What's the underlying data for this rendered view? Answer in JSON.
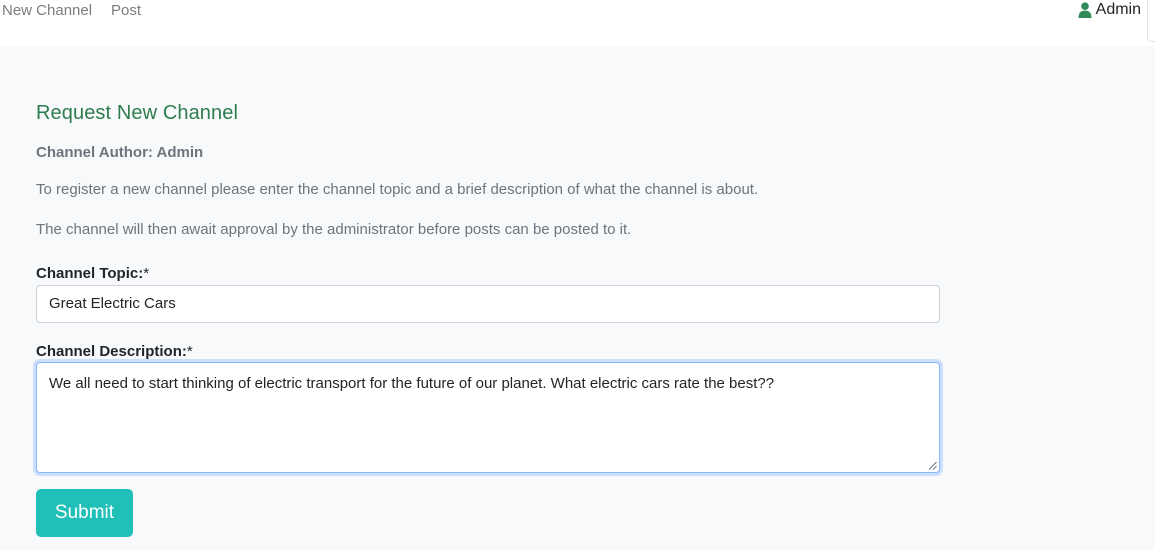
{
  "nav": {
    "new_channel": "New Channel",
    "post": "Post",
    "user_name": "Admin",
    "user_icon": "user-icon"
  },
  "form": {
    "heading": "Request New Channel",
    "author_line": "Channel Author: Admin",
    "intro_1": "To register a new channel please enter the channel topic and a brief description of what the channel is about.",
    "intro_2": "The channel will then await approval by the administrator before posts can be posted to it.",
    "topic_label": "Channel Topic:",
    "topic_required": "*",
    "topic_value": "Great Electric Cars",
    "description_label": "Channel Description:",
    "description_required": "*",
    "description_value": "We all need to start thinking of electric transport for the future of our planet. What electric cars rate the best??",
    "submit_label": "Submit"
  },
  "colors": {
    "heading": "#2e7d4f",
    "submit": "#20c0b9",
    "user_icon": "#2e8b57",
    "page_bg": "#f8f9fa"
  }
}
